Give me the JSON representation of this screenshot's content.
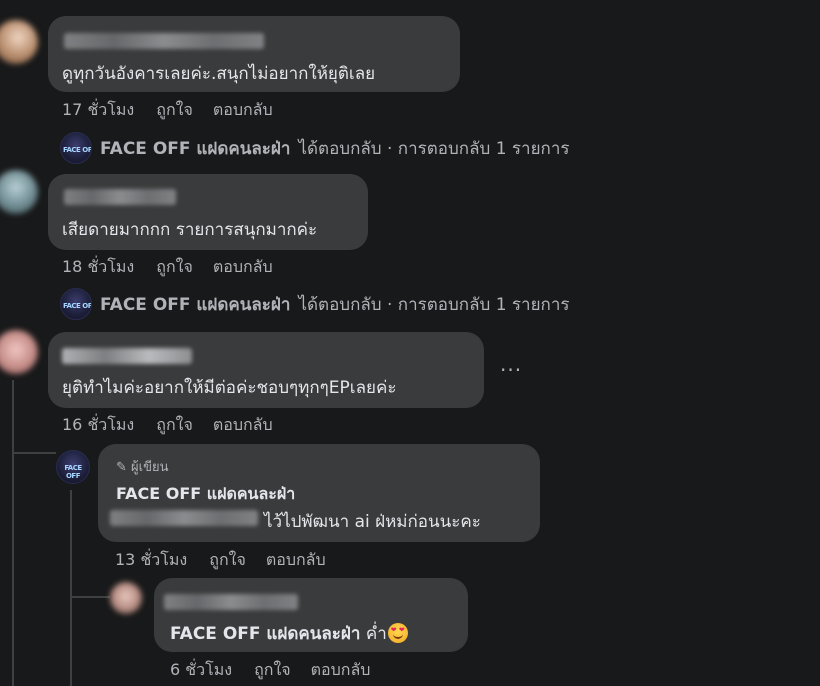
{
  "page_name": "FACE OFF แฝดคนละฝ่า",
  "comments": [
    {
      "text": "ดูทุกวันอังคารเลยค่ะ.สนุกไม่อยากให้ยุติเลย",
      "time": "17 ชั่วโมง",
      "like": "ถูกใจ",
      "reply": "ตอบกลับ",
      "reply_summary": {
        "page": "FACE OFF แฝดคนละฝ่า",
        "action": "ได้ตอบกลับ · การตอบกลับ 1 รายการ"
      }
    },
    {
      "text": "เสียดายมากกก รายการสนุกมากค่ะ",
      "time": "18 ชั่วโมง",
      "like": "ถูกใจ",
      "reply": "ตอบกลับ",
      "reply_summary": {
        "page": "FACE OFF แฝดคนละฝ่า",
        "action": "ได้ตอบกลับ · การตอบกลับ 1 รายการ"
      }
    },
    {
      "text": "ยุติทำไมค่ะอยากให้มีต่อค่ะชอบๆทุกๆEPเลยค่ะ",
      "time": "16 ชั่วโมง",
      "like": "ถูกใจ",
      "reply": "ตอบกลับ",
      "more": "···"
    }
  ],
  "author_reply": {
    "badge": "ผู้เขียน",
    "author": "FACE OFF แฝดคนละฝ่า",
    "text": "ไว้ไปพัฒนา ai ฝ่หม่ก่อนนะคะ",
    "time": "13 ชั่วโมง",
    "like": "ถูกใจ",
    "reply": "ตอบกลับ"
  },
  "nested_reply": {
    "mention": "FACE OFF แฝดคนละฝ่า",
    "text": " ค่ำ",
    "time": "6 ชั่วโมง",
    "like": "ถูกใจ",
    "reply": "ตอบกลับ"
  },
  "icons": {
    "reply_arrow": "reply-arrow-icon",
    "pencil": "pencil-icon",
    "more": "more-options-icon",
    "emoji": "heart-eyes-emoji"
  },
  "colors": {
    "background": "#18191a",
    "bubble": "#3a3b3c",
    "text": "#e4e6eb",
    "secondary": "#b0b3b8"
  }
}
